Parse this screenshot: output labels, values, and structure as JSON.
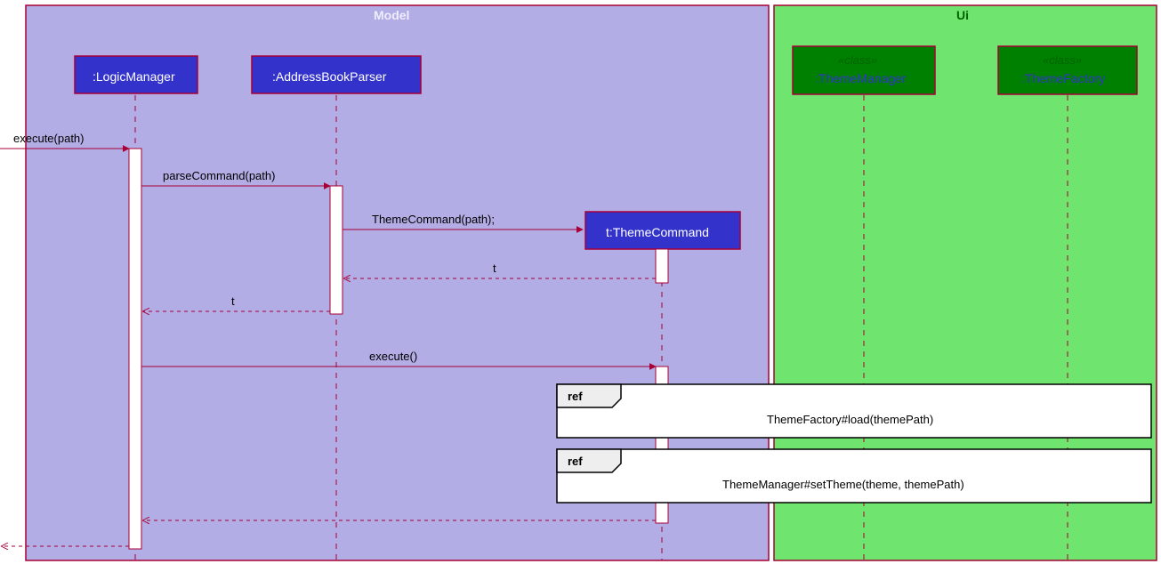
{
  "packages": {
    "model": {
      "title": "Model"
    },
    "ui": {
      "title": "Ui"
    }
  },
  "participants": {
    "logicManager": {
      "label": ":LogicManager"
    },
    "addressBookParser": {
      "label": ":AddressBookParser"
    },
    "themeCommand": {
      "label": "t:ThemeCommand"
    },
    "themeManager": {
      "stereotype": "«class»",
      "label": ":ThemeManager"
    },
    "themeFactory": {
      "stereotype": "«class»",
      "label": ":ThemeFactory"
    }
  },
  "messages": {
    "executePath": "execute(path)",
    "parseCommand": "parseCommand(path)",
    "themeCommandCtor": "ThemeCommand(path);",
    "returnT1": "t",
    "returnT2": "t",
    "execute": "execute()"
  },
  "refs": {
    "ref1": {
      "label": "ref",
      "text": "ThemeFactory#load(themePath)"
    },
    "ref2": {
      "label": "ref",
      "text": "ThemeManager#setTheme(theme, themePath)"
    }
  }
}
